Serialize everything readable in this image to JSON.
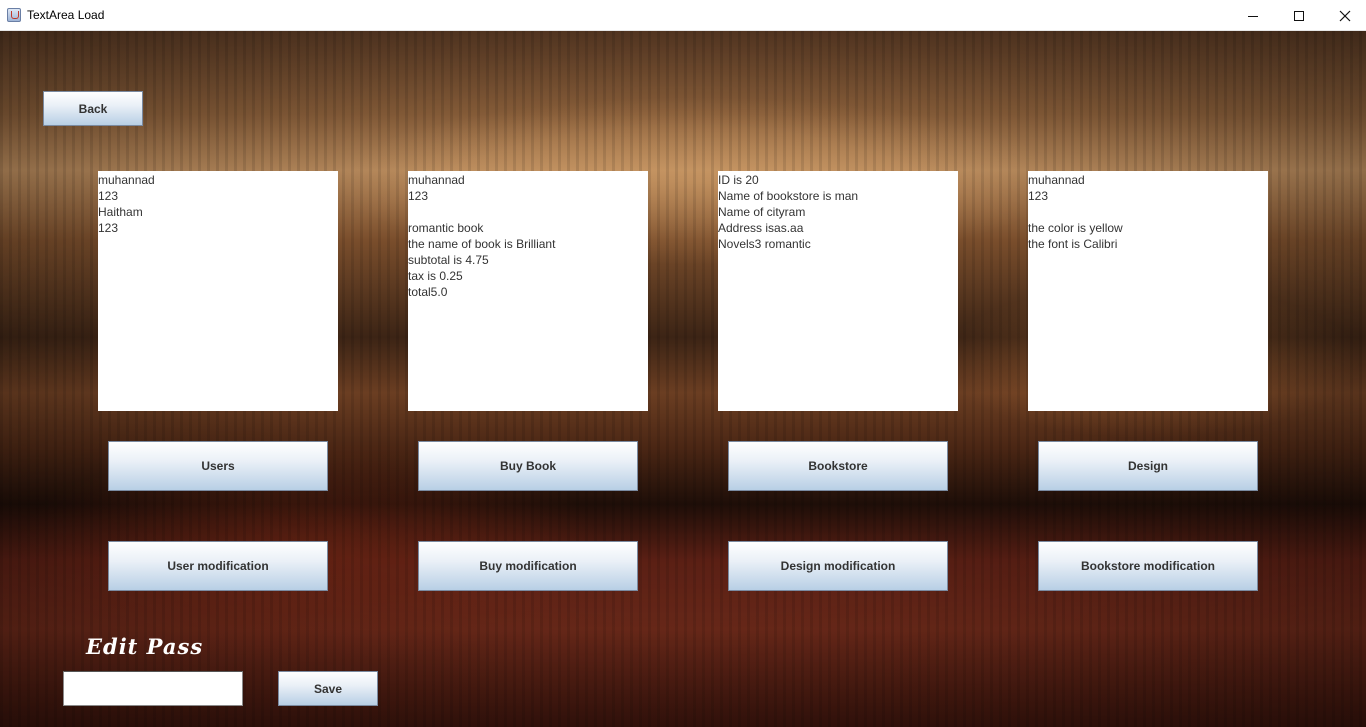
{
  "window": {
    "title": "TextArea Load",
    "minimize_icon": "minimize-icon",
    "maximize_icon": "maximize-icon",
    "close_icon": "close-icon"
  },
  "toolbar": {
    "back_label": "Back"
  },
  "text_areas": [
    {
      "name": "users",
      "text": "muhannad\n123\nHaitham\n123"
    },
    {
      "name": "buy-book",
      "text": "muhannad\n123\n\nromantic book\nthe name of book is Brilliant\nsubtotal is 4.75\ntax is 0.25\ntotal5.0"
    },
    {
      "name": "bookstore",
      "text": "ID is 20\nName of bookstore is man\nName of cityram\nAddress isas.aa\nNovels3 romantic"
    },
    {
      "name": "design",
      "text": "muhannad\n123\n\nthe color is yellow\nthe font is Calibri"
    }
  ],
  "load_buttons": [
    "Users",
    "Buy Book",
    "Bookstore",
    "Design"
  ],
  "modification_buttons": [
    "User modification",
    "Buy modification",
    "Design modification",
    "Bookstore modification"
  ],
  "edit_pass": {
    "label": "Edit Pass",
    "value": "",
    "save_label": "Save"
  }
}
